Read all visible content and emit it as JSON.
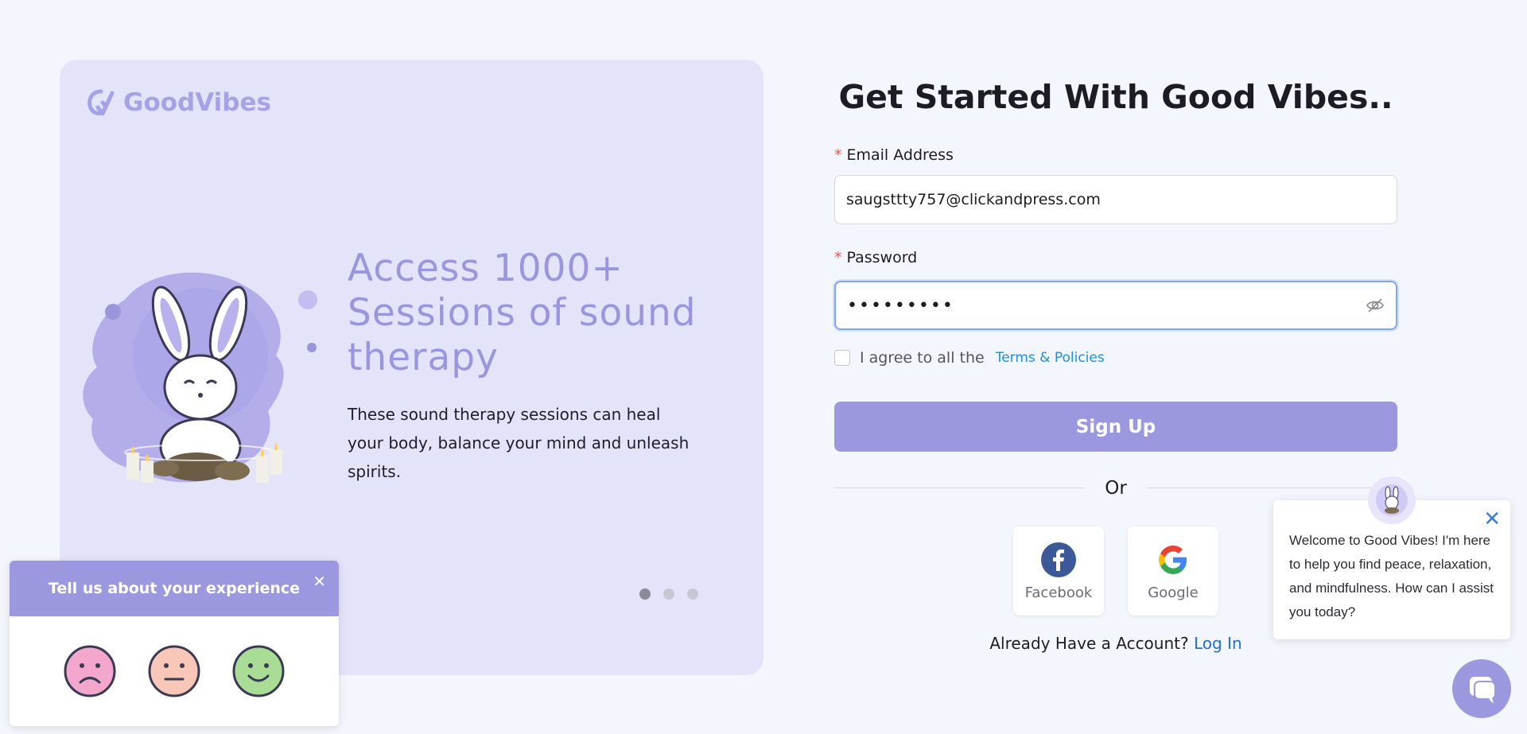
{
  "brand": {
    "name": "GoodVibes",
    "accent": "#9b98e0",
    "hero_bg": "#e3e3fa"
  },
  "hero": {
    "title": "Access 1000+ Sessions of sound therapy",
    "description": "These sound therapy sessions can heal your body, balance your mind and unleash spirits.",
    "carousel": {
      "total": 3,
      "active": 1
    }
  },
  "form": {
    "title": "Get Started With Good Vibes..",
    "email": {
      "label": "Email Address",
      "value": "saugsttty757@clickandpress.com"
    },
    "password": {
      "label": "Password",
      "value": "•••••••••"
    },
    "agree_text": "I agree to all the",
    "terms_link": "Terms & Policies",
    "submit_label": "Sign Up",
    "divider_text": "Or",
    "social": [
      {
        "label": "Facebook",
        "icon": "facebook-icon"
      },
      {
        "label": "Google",
        "icon": "google-icon"
      }
    ],
    "login_prompt": "Already Have a Account?",
    "login_link": "Log In"
  },
  "feedback": {
    "title": "Tell us about your experience",
    "close": "✕",
    "faces": [
      "sad-face-icon",
      "neutral-face-icon",
      "happy-face-icon"
    ]
  },
  "chat": {
    "message": "Welcome to Good Vibes! I'm here to help you find peace, relaxation, and mindfulness. How can I assist you today?",
    "close": "✕"
  }
}
